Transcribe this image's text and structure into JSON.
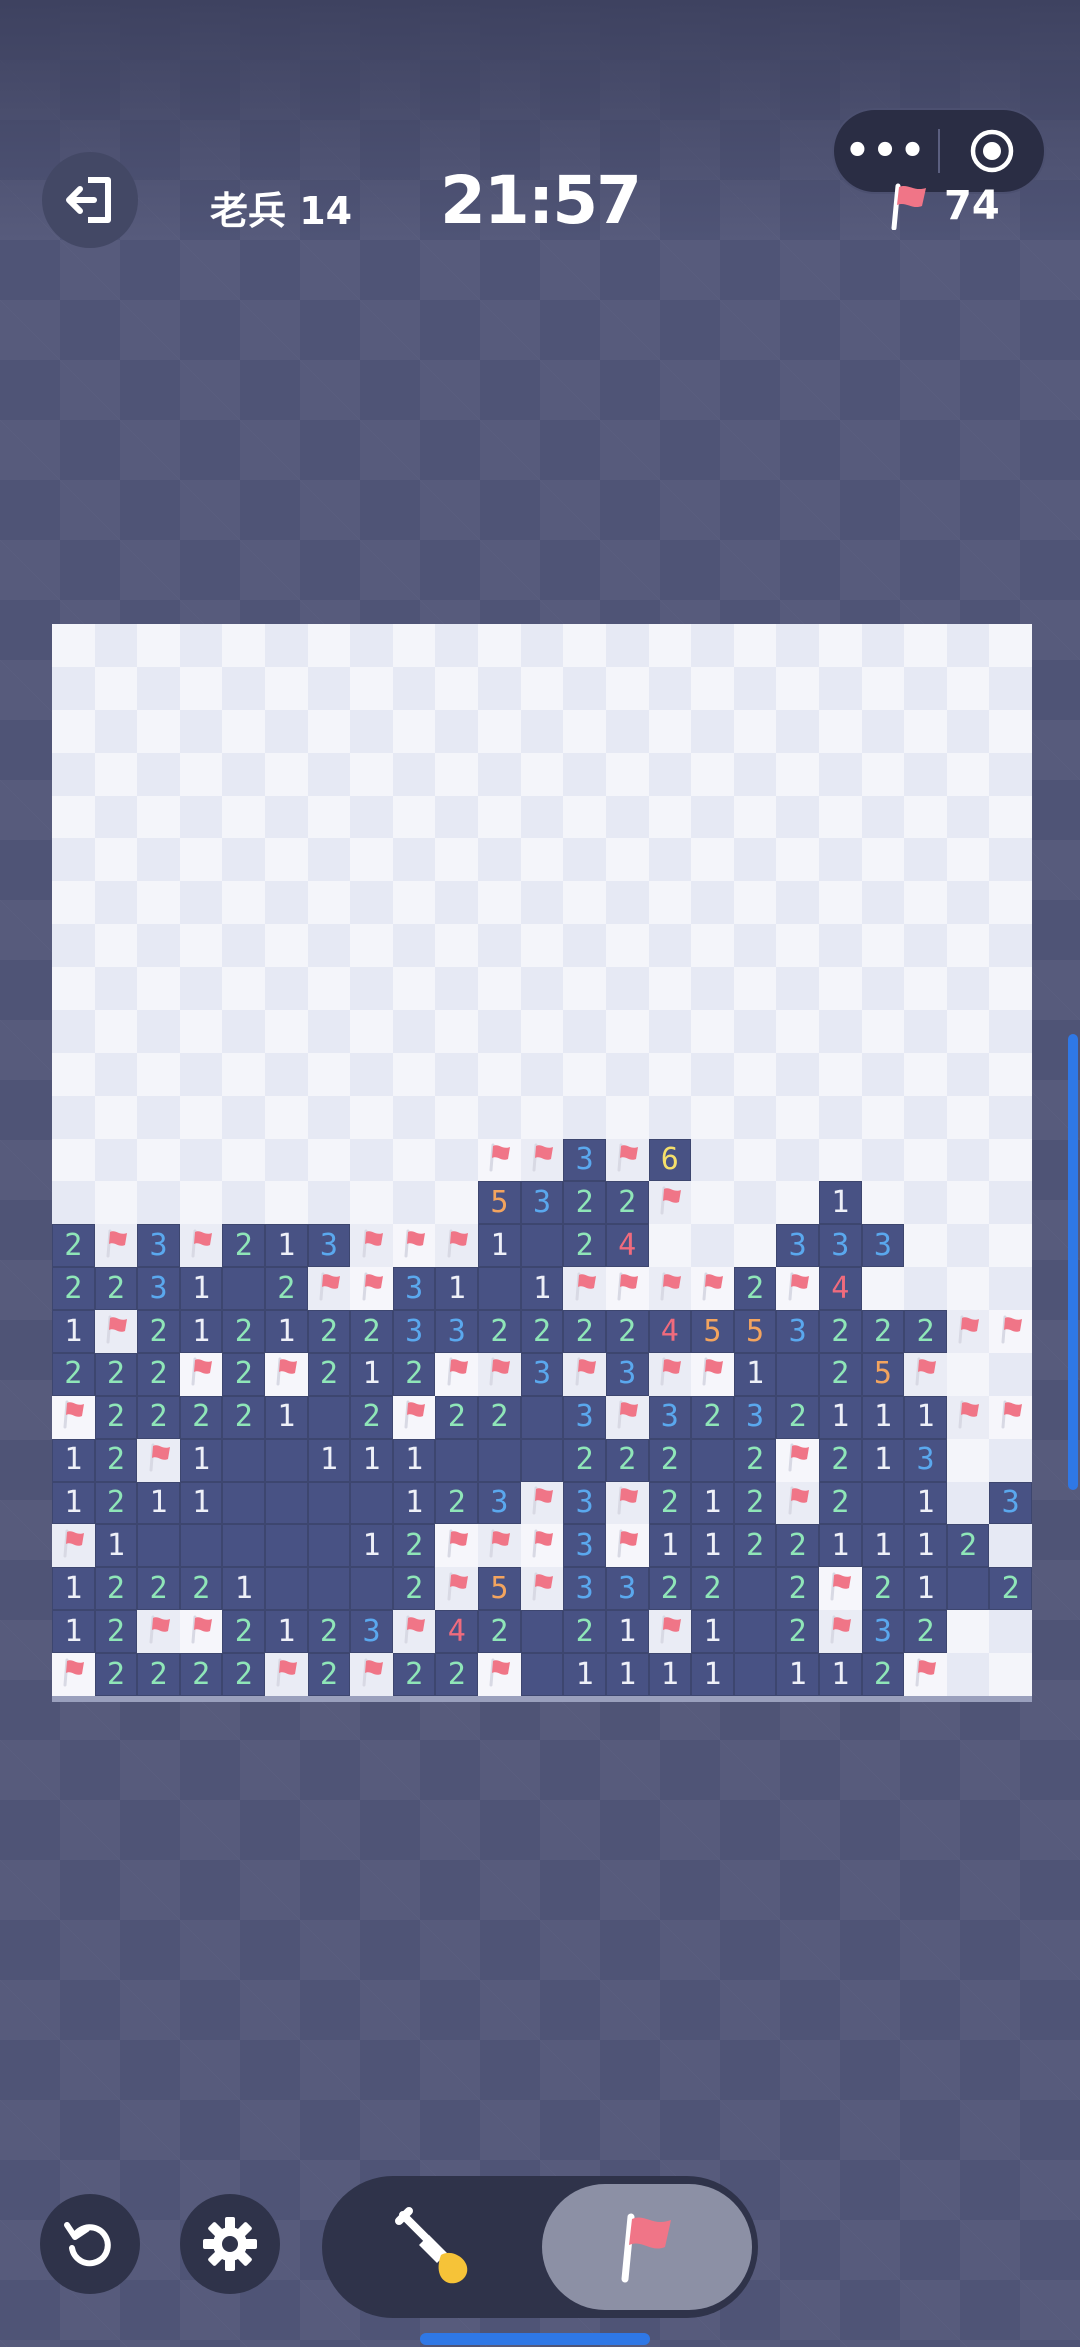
{
  "header": {
    "level_label": "老兵 14",
    "timer": "21:57",
    "flags_remaining": "74",
    "menu_more": "•••"
  },
  "icons": [
    "exit-icon",
    "more-icon",
    "target-icon",
    "flag-icon",
    "undo-icon",
    "gear-icon",
    "shovel-icon"
  ],
  "colors": {
    "revealed": "#485284",
    "hidden_light": "#f4f5fa",
    "hidden_dark": "#e6e9f4",
    "n1": "#eef0f8",
    "n2": "#8fe6b8",
    "n3": "#5aa8ee",
    "n4": "#f06b7d",
    "n5": "#f3a45e",
    "n6": "#f5df6a",
    "flag": "#f07587"
  },
  "board": {
    "columns": 23,
    "rows": 25,
    "legend": ". = hidden, _ = revealed empty, F = flag, digits = revealed numbers",
    "grid": [
      ".......................",
      ".......................",
      ".......................",
      ".......................",
      ".......................",
      ".......................",
      ".......................",
      ".......................",
      ".......................",
      ".......................",
      ".......................",
      ".......................",
      "..........FF3F6........",
      "..........5322F...1....",
      "2F3F213FFF1_24...333...",
      "2231_2FF31_1FFFF2F4....",
      "1F2121223322224553222FF",
      "222F2F212FF3F3FF1_25F..",
      "F22221_2F22_3F3232111FF",
      "12F1__111___222_2F213..",
      "1211____123F3F212F2_1.3",
      "F1_____12FFF3F11221112",
      "12221___2F5F3322_2F21_2",
      "12FF2123F42_21F1_2F32..",
      "F2222F2F22F_1111_112F.."
    ]
  }
}
